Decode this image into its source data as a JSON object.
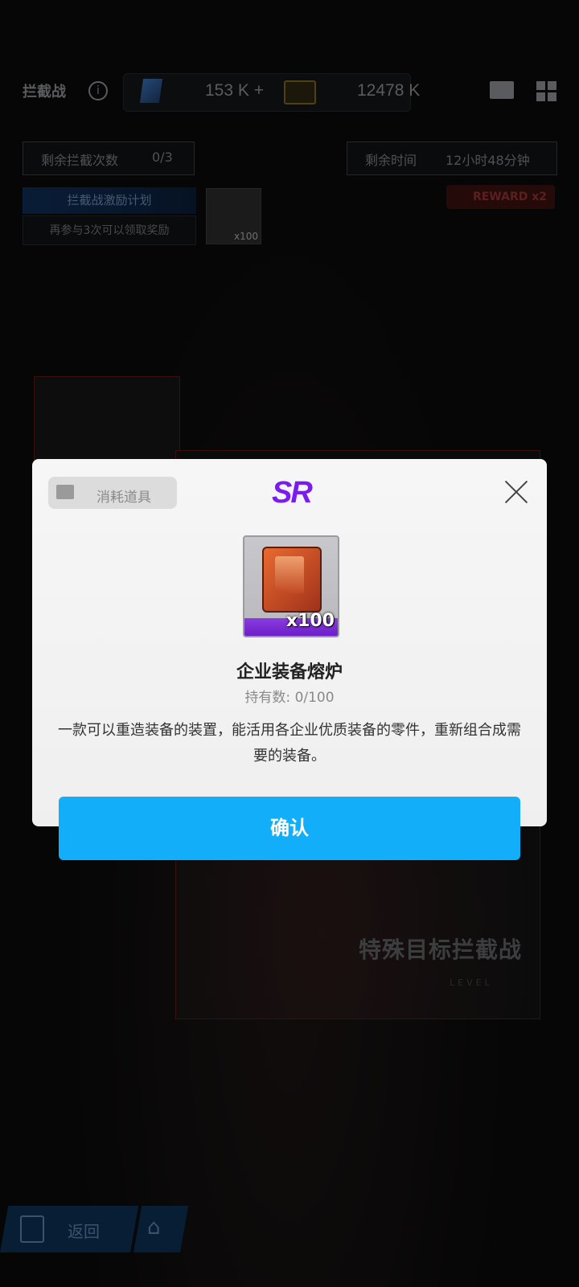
{
  "header": {
    "title": "拦截战",
    "resource1": "153 K +",
    "resource2": "12478 K"
  },
  "stats": {
    "remaining_label": "剩余拦截次数",
    "remaining_value": "0/3",
    "time_label": "剩余时间",
    "time_value": "12小时48分钟",
    "reward_badge": "REWARD x2"
  },
  "incentive": {
    "title": "拦截战激励计划",
    "subtitle": "再参与3次可以领取奖励",
    "item_count": "x100"
  },
  "stage": {
    "title": "特殊目标拦截战",
    "level": "LEVEL"
  },
  "bottom_nav": {
    "back_label": "返回"
  },
  "modal": {
    "type_tag": "消耗道具",
    "rarity": "SR",
    "item_count": "x100",
    "item_name": "企业装备熔炉",
    "owned": "持有数: 0/100",
    "description": "一款可以重造装备的装置，能活用各企业优质装备的零件，重新组合成需要的装备。",
    "confirm_label": "确认"
  },
  "colors": {
    "confirm": "#13aef9",
    "rarity": "#7a1bf0"
  }
}
